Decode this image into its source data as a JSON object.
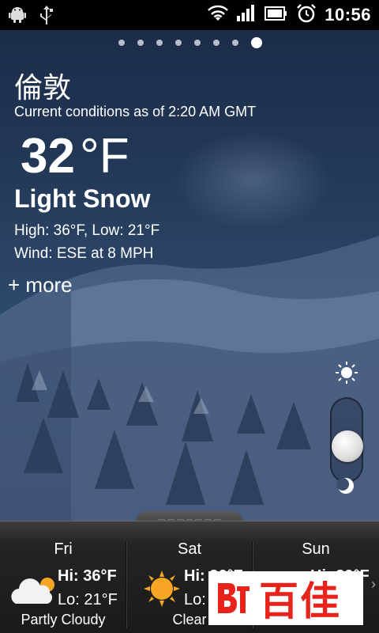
{
  "status_bar": {
    "left_icons": [
      "android-icon",
      "usb-icon"
    ],
    "right_icons": [
      "wifi-icon",
      "signal-icon",
      "battery-icon",
      "alarm-icon"
    ],
    "time": "10:56"
  },
  "pager": {
    "total": 8,
    "active_index": 7
  },
  "conditions": {
    "city": "倫敦",
    "as_of": "Current conditions as of  2:20 AM GMT",
    "temperature": "32",
    "unit": "°F",
    "description": "Light Snow",
    "high_low": "High: 36°F, Low: 21°F",
    "wind": "Wind: ESE at 8 MPH",
    "more_label": "+ more"
  },
  "day_night_toggle": {
    "top_icon": "sun-icon",
    "bottom_icon": "moon-icon"
  },
  "forecast": [
    {
      "day": "Fri",
      "hi_label": "Hi:",
      "hi": "36°F",
      "lo_label": "Lo:",
      "lo": "21°F",
      "desc": "Partly Cloudy",
      "icon": "partly-cloudy-icon"
    },
    {
      "day": "Sat",
      "hi_label": "Hi:",
      "hi": "36°F",
      "lo_label": "Lo:",
      "lo": "",
      "desc": "Clear",
      "icon": "sunny-icon"
    },
    {
      "day": "Sun",
      "hi_label": "Hi:",
      "hi": "39°F",
      "lo_label": "",
      "lo": "",
      "desc": "",
      "icon": ""
    }
  ],
  "watermark": {
    "logo_text": "百佳"
  },
  "colors": {
    "accent_red": "#e8231b"
  }
}
